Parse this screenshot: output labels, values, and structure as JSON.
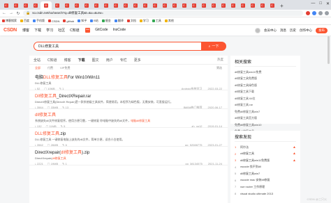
{
  "browser": {
    "tabs": [
      {
        "icon": "C",
        "active": false
      },
      {
        "icon": "C",
        "active": false
      },
      {
        "icon": "C",
        "active": false
      },
      {
        "icon": "C",
        "active": false
      },
      {
        "icon": "D",
        "active": true,
        "title": "D"
      },
      {
        "icon": "C",
        "active": false
      },
      {
        "icon": "C",
        "active": false
      },
      {
        "icon": "C",
        "active": false
      },
      {
        "icon": "C",
        "active": false
      },
      {
        "icon": "C",
        "active": false
      },
      {
        "icon": "C",
        "active": false
      },
      {
        "icon": "C",
        "active": false
      },
      {
        "icon": "C",
        "active": false
      },
      {
        "icon": "C",
        "active": false
      },
      {
        "icon": "C",
        "active": false
      },
      {
        "icon": "C",
        "active": false
      },
      {
        "icon": "C",
        "active": false
      },
      {
        "icon": "C",
        "active": false
      },
      {
        "icon": "C",
        "active": false
      },
      {
        "icon": "C",
        "active": false
      },
      {
        "icon": "C",
        "active": false
      },
      {
        "icon": "C",
        "active": false
      },
      {
        "icon": "C",
        "active": false
      },
      {
        "icon": "C",
        "active": false
      },
      {
        "icon": "C",
        "active": false
      },
      {
        "icon": "C",
        "active": false
      },
      {
        "icon": "C",
        "active": false
      },
      {
        "icon": "C",
        "active": false
      }
    ],
    "new_tab": "+",
    "window_controls": {
      "minimize": "—",
      "maximize": "□",
      "close": "✕"
    },
    "url": "so.csdn.net/so/search?q=dll修复工具&t=&u=&urw=",
    "bookmarks": [
      "博客搜索",
      "百度",
      "手机版",
      "CSDN",
      "github",
      "知乎",
      "B站",
      "掘金",
      "翻译",
      "文档",
      "学习",
      "工具",
      "其他"
    ]
  },
  "csdn": {
    "logo": "CSDN",
    "nav": [
      "博客",
      "下载",
      "学习",
      "社区",
      "C知道",
      "GitCode",
      "InsCode"
    ],
    "new_badge": "new",
    "right": [
      "会员中心",
      "消息",
      "历史",
      "创作中心"
    ],
    "publish": "发布"
  },
  "search": {
    "query": "DLL修复工具",
    "button": "一下"
  },
  "tabs": {
    "items": [
      "全站",
      "C知道",
      "博客",
      "下载",
      "图文",
      "用户",
      "专栏",
      "更多"
    ],
    "active_index": 3,
    "sort": "热度"
  },
  "subtabs": {
    "items": [
      "全部",
      "付费",
      "VIP免费"
    ],
    "active_index": 0,
    "sort": "筛选"
  },
  "results": [
    {
      "title_pre": "电脑",
      "title_hl": "DLL修复工具",
      "title_post": "For Win10/Win11",
      "desc": "DLL修复工具",
      "desc_hl": "",
      "meta": [
        "52",
        "10MB",
        "1"
      ],
      "source": "Android系统学习",
      "date": "2022-03-22"
    },
    {
      "title_pre": "",
      "title_hl": "Dll修复工具",
      "title_post": "_DirectXRepair.rar",
      "desc": "DirectX修复工具(DirectX Repair)是一款系统级工具软件，简便易用。本程序为绿色版，无需安装，可直接运行。",
      "desc_hl": "",
      "meta": [
        "3564",
        "33MB",
        "13"
      ],
      "source": "BiliBili热门推荐",
      "date": "2020-06-17"
    },
    {
      "title_pre": "",
      "title_hl": "dll修复工具",
      "title_post": "",
      "desc": "系统缺失dll文件修复程序，使用方便可靠，一键修复 你电脑中缺失的dll文件，",
      "desc_hl": "电脑dll修复工具",
      "meta": [
        "132",
        "11MB",
        "5"
      ],
      "source": "zh_xp12",
      "date": "2019-01-14"
    },
    {
      "title_pre": "",
      "title_hl": "DLL修复工具",
      "title_post": ".zip",
      "desc": "DLL修复工具 一键修复电脑上缺失的dll文件，简单方便，适合小白使用。",
      "desc_hl": "",
      "meta": [
        "3562",
        "26MB",
        "6"
      ],
      "source": "qq_52088775",
      "date": "2023-01-27"
    },
    {
      "title_pre": "DirectXrepair(",
      "title_hl": "dll修复工具",
      "title_post": ").zip",
      "desc": "DirectXrepair(",
      "desc_hl": "dll修复工具",
      "meta": [
        "2221",
        "19MB",
        "1"
      ],
      "source": "qq_38134575",
      "date": "2021-11-24"
    }
  ],
  "related": {
    "title": "相关搜索",
    "items": [
      "dll修复工具win10免费",
      "dll修复工具免费版",
      "dll修复工具绿色版",
      "dll修复工具下载",
      "dll修复工具 64位",
      "dll修复工具.rar",
      "免费dll修复工具win7",
      "dll修复工具官方版",
      "免费dll修复工具win10",
      "免费dll修复工具"
    ]
  },
  "discover": {
    "title": "搜索发现",
    "items": [
      "阿尔法",
      "cti修复工具",
      "dll修复工具win11免费版",
      "vscode 找不到dll",
      "dll修复工具win7",
      "vscode mac 安装dll修复",
      "vue router 工作原理",
      "visual studio ultimate 2013"
    ]
  },
  "watermark": "CSDN @三只火",
  "colors": {
    "accent": "#fc5531"
  }
}
